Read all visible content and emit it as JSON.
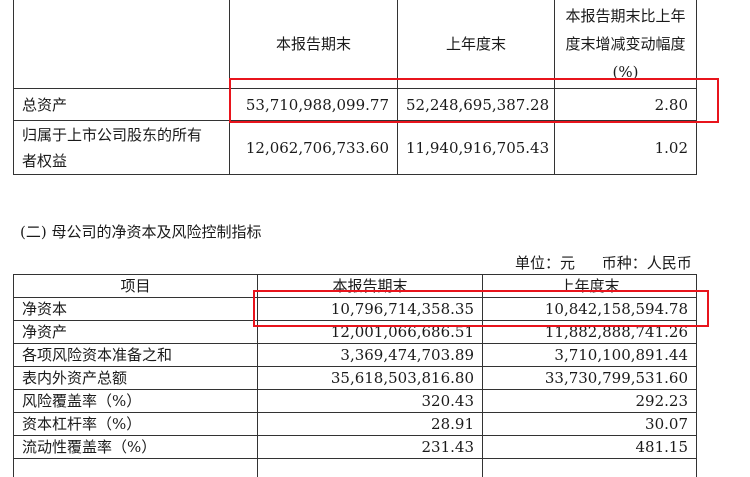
{
  "table1": {
    "headers": [
      "",
      "本报告期末",
      "上年度末",
      "本报告期末比上年度末增减变动幅度(%)"
    ],
    "header_change_lines": [
      "本报告期末比上年",
      "度末增减变动幅度",
      "(%)"
    ],
    "rows": [
      {
        "label": "总资产",
        "current": "53,710,988,099.77",
        "prior": "52,248,695,387.28",
        "change": "2.80"
      },
      {
        "label": "归属于上市公司股东的所有者权益",
        "label_lines": [
          "归属于上市公司股东的所有",
          "者权益"
        ],
        "current": "12,062,706,733.60",
        "prior": "11,940,916,705.43",
        "change": "1.02"
      }
    ]
  },
  "section": {
    "title": "(二) 母公司的净资本及风险控制指标",
    "unit_label": "单位：元",
    "currency_label": "币种：人民币"
  },
  "table2": {
    "headers": [
      "项目",
      "本报告期末",
      "上年度末"
    ],
    "rows": [
      {
        "label": "净资本",
        "current": "10,796,714,358.35",
        "prior": "10,842,158,594.78"
      },
      {
        "label": "净资产",
        "current": "12,001,066,686.51",
        "prior": "11,882,888,741.26"
      },
      {
        "label": "各项风险资本准备之和",
        "current": "3,369,474,703.89",
        "prior": "3,710,100,891.44"
      },
      {
        "label": "表内外资产总额",
        "current": "35,618,503,816.80",
        "prior": "33,730,799,531.60"
      },
      {
        "label": "风险覆盖率（%）",
        "current": "320.43",
        "prior": "292.23"
      },
      {
        "label": "资本杠杆率（%）",
        "current": "28.91",
        "prior": "30.07"
      },
      {
        "label": "流动性覆盖率（%）",
        "current": "231.43",
        "prior": "481.15"
      }
    ]
  },
  "highlight_color": "#e8141c"
}
